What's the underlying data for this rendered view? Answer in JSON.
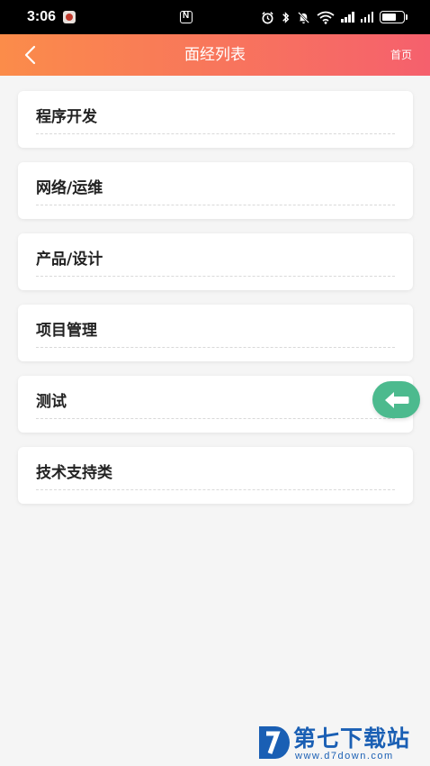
{
  "status_bar": {
    "time": "3:06",
    "battery_level": 0.7
  },
  "header": {
    "title": "面经列表",
    "home_label": "首页",
    "gradient_start": "#fb8c4a",
    "gradient_end": "#f5606d"
  },
  "categories": [
    {
      "label": "程序开发"
    },
    {
      "label": "网络/运维"
    },
    {
      "label": "产品/设计"
    },
    {
      "label": "项目管理"
    },
    {
      "label": "测试"
    },
    {
      "label": "技术支持类"
    }
  ],
  "float_button": {
    "icon": "arrow-left-icon",
    "color": "#4cba8e"
  },
  "watermark": {
    "brand": "第七下载站",
    "url": "www.d7down.com"
  }
}
